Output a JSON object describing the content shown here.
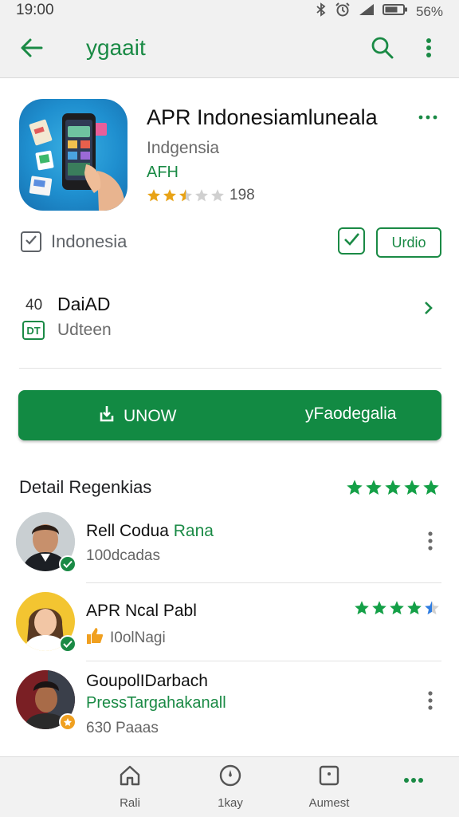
{
  "status_bar": {
    "time": "19:00",
    "battery": "56%"
  },
  "app_bar": {
    "title": "ygaait"
  },
  "app": {
    "title": "APR Indonesiamluneala",
    "developer": "Indgensia",
    "category": "AFH",
    "rating_count": "198",
    "rating": 2.5
  },
  "region": {
    "label": "Indonesia",
    "button_label": "Urdio"
  },
  "info_row": {
    "prefix": "40",
    "title": "DaiAD",
    "badge": "DT",
    "subtitle": "Udteen"
  },
  "primary_button": {
    "left_label": "UNOW",
    "right_label": "yFaodegalia"
  },
  "reviews_section": {
    "title": "Detail Regenkias",
    "rating": 5
  },
  "reviews": [
    {
      "name": "Rell Codua ",
      "name_accent": "Rana",
      "meta": "100dcadas"
    },
    {
      "name": "APR Ncal Pabl",
      "meta": "I0olNagi",
      "rating": 4.5
    },
    {
      "name": "GoupolIDarbach",
      "subtitle": "PressTargahakanall",
      "meta": "630 Paaas"
    }
  ],
  "bottom_nav": [
    {
      "label": "Rali",
      "icon": "home-icon"
    },
    {
      "label": "1kay",
      "icon": "compass-icon"
    },
    {
      "label": "Aumest",
      "icon": "apps-icon"
    },
    {
      "label": "",
      "icon": "more-icon"
    }
  ],
  "colors": {
    "accent": "#1a8a45",
    "primary_button": "#128a43",
    "star": "#e8a317",
    "star_green": "#14a047",
    "star_blue": "#2f7de1"
  }
}
